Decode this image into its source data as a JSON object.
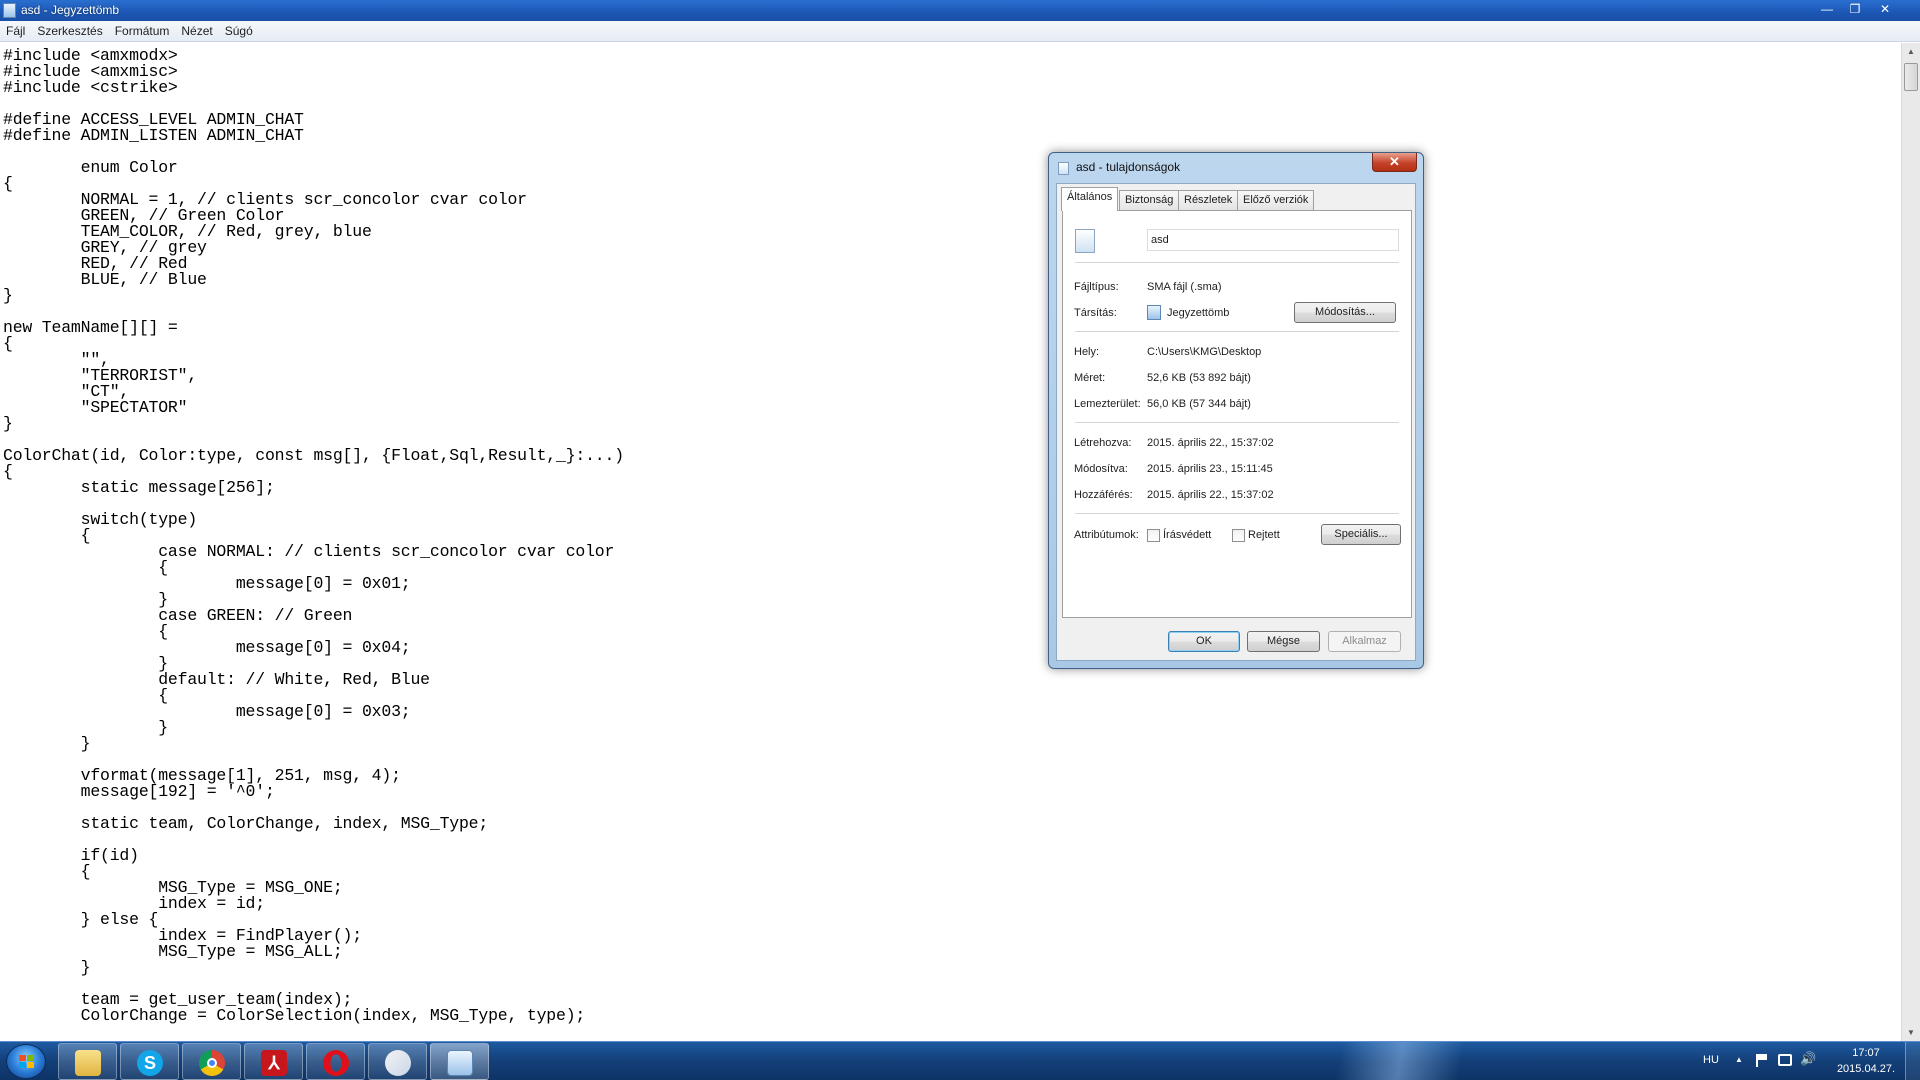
{
  "window": {
    "title": "asd - Jegyzettömb",
    "minimize": "—",
    "maximize": "❐",
    "close": "✕"
  },
  "menu": [
    "Fájl",
    "Szerkesztés",
    "Formátum",
    "Nézet",
    "Súgó"
  ],
  "editor": {
    "lines": [
      "#include <amxmodx>",
      "#include <amxmisc>",
      "#include <cstrike>",
      "",
      "#define ACCESS_LEVEL ADMIN_CHAT",
      "#define ADMIN_LISTEN ADMIN_CHAT",
      "",
      "        enum Color",
      "{",
      "        NORMAL = 1, // clients scr_concolor cvar color",
      "        GREEN, // Green Color",
      "        TEAM_COLOR, // Red, grey, blue",
      "        GREY, // grey",
      "        RED, // Red",
      "        BLUE, // Blue",
      "}",
      "",
      "new TeamName[][] =",
      "{",
      "        \"\",",
      "        \"TERRORIST\",",
      "        \"CT\",",
      "        \"SPECTATOR\"",
      "}",
      "",
      "ColorChat(id, Color:type, const msg[], {Float,Sql,Result,_}:...)",
      "{",
      "        static message[256];",
      "",
      "        switch(type)",
      "        {",
      "                case NORMAL: // clients scr_concolor cvar color",
      "                {",
      "                        message[0] = 0x01;",
      "                }",
      "                case GREEN: // Green",
      "                {",
      "                        message[0] = 0x04;",
      "                }",
      "                default: // White, Red, Blue",
      "                {",
      "                        message[0] = 0x03;",
      "                }",
      "        }",
      "",
      "        vformat(message[1], 251, msg, 4);",
      "        message[192] = '^0';",
      "",
      "        static team, ColorChange, index, MSG_Type;",
      "",
      "        if(id)",
      "        {",
      "                MSG_Type = MSG_ONE;",
      "                index = id;",
      "        } else {",
      "                index = FindPlayer();",
      "                MSG_Type = MSG_ALL;",
      "        }",
      "",
      "        team = get_user_team(index);",
      "        ColorChange = ColorSelection(index, MSG_Type, type);"
    ]
  },
  "dialog": {
    "title": "asd - tulajdonságok",
    "close": "✕",
    "tabs": [
      "Általános",
      "Biztonság",
      "Részletek",
      "Előző verziók"
    ],
    "filename": "asd",
    "file_type_label": "Fájltípus:",
    "file_type_value": "SMA fájl (.sma)",
    "opens_with_label": "Társítás:",
    "opens_with_value": "Jegyzettömb",
    "change_button": "Módosítás...",
    "location_label": "Hely:",
    "location_value": "C:\\Users\\KMG\\Desktop",
    "size_label": "Méret:",
    "size_value": "52,6 KB (53 892 bájt)",
    "size_on_disk_label": "Lemezterület:",
    "size_on_disk_value": "56,0 KB (57 344 bájt)",
    "created_label": "Létrehozva:",
    "created_value": "2015. április 22., 15:37:02",
    "modified_label": "Módosítva:",
    "modified_value": "2015. április 23., 15:11:45",
    "accessed_label": "Hozzáférés:",
    "accessed_value": "2015. április 22., 15:37:02",
    "attributes_label": "Attribútumok:",
    "readonly_label": "Írásvédett",
    "hidden_label": "Rejtett",
    "advanced_button": "Speciális...",
    "ok_button": "OK",
    "cancel_button": "Mégse",
    "apply_button": "Alkalmaz"
  },
  "taskbar": {
    "apps": [
      "explorer-icon",
      "skype-icon",
      "chrome-icon",
      "acrobat-icon",
      "opera-icon",
      "paint-icon",
      "notepad-icon"
    ],
    "skype_glyph": "S",
    "acrobat_glyph": "⅄",
    "language": "HU",
    "tray_arrow": "▲",
    "time": "17:07",
    "date": "2015.04.27."
  },
  "colors": {
    "titlebar": "#1c57b4",
    "taskbar": "#133f78",
    "dialog_frame": "#a9c8e6"
  }
}
